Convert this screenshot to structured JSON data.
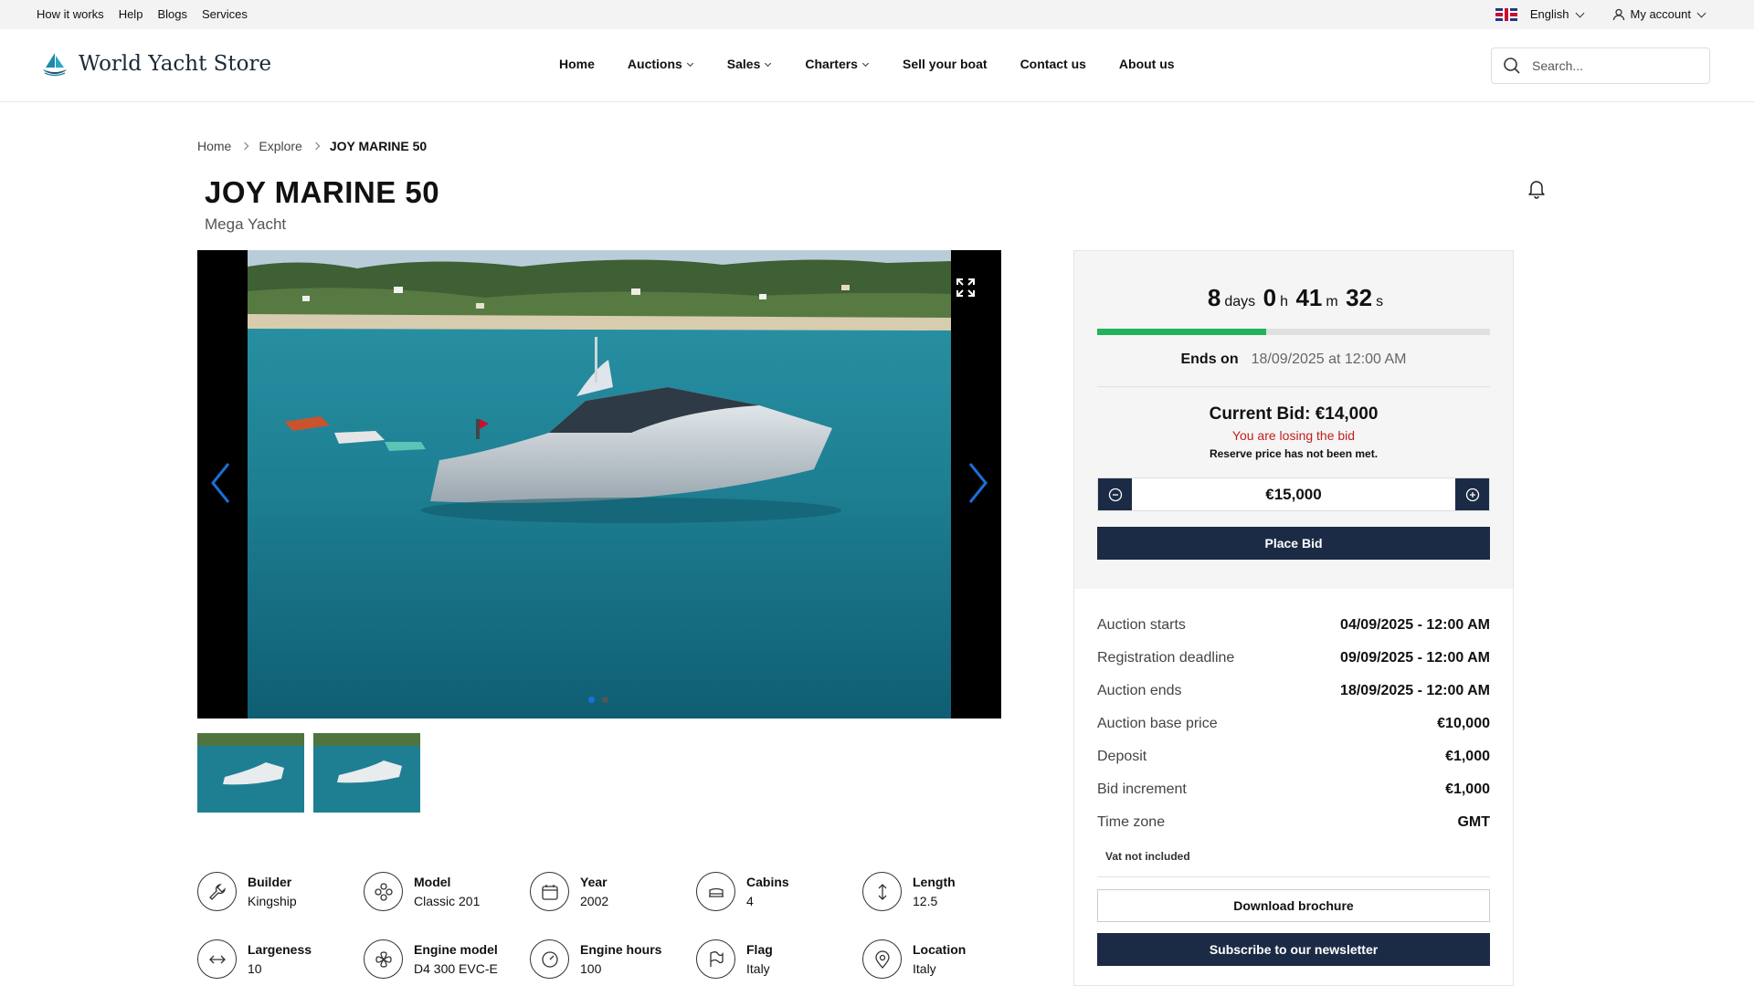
{
  "topbar": {
    "links": [
      "How it works",
      "Help",
      "Blogs",
      "Services"
    ],
    "language": "English",
    "account": "My account"
  },
  "brand": {
    "name": "World Yacht Store"
  },
  "nav": {
    "items": [
      {
        "label": "Home",
        "dropdown": false
      },
      {
        "label": "Auctions",
        "dropdown": true
      },
      {
        "label": "Sales",
        "dropdown": true
      },
      {
        "label": "Charters",
        "dropdown": true
      },
      {
        "label": "Sell your boat",
        "dropdown": false
      },
      {
        "label": "Contact us",
        "dropdown": false
      },
      {
        "label": "About us",
        "dropdown": false
      }
    ]
  },
  "search": {
    "placeholder": "Search..."
  },
  "breadcrumb": {
    "home": "Home",
    "explore": "Explore",
    "current": "JOY MARINE 50"
  },
  "listing": {
    "title": "JOY MARINE 50",
    "subtitle": "Mega Yacht"
  },
  "gallery": {
    "slides": 2,
    "active_slide": 1
  },
  "specs": [
    {
      "label": "Builder",
      "value": "Kingship",
      "icon": "wrench-icon"
    },
    {
      "label": "Model",
      "value": "Classic 201",
      "icon": "model-icon"
    },
    {
      "label": "Year",
      "value": "2002",
      "icon": "calendar-icon"
    },
    {
      "label": "Cabins",
      "value": "4",
      "icon": "bed-icon"
    },
    {
      "label": "Length",
      "value": "12.5",
      "icon": "length-icon"
    },
    {
      "label": "Largeness",
      "value": "10",
      "icon": "width-icon"
    },
    {
      "label": "Engine model",
      "value": "D4 300 EVC-E",
      "icon": "engine-icon"
    },
    {
      "label": "Engine hours",
      "value": "100",
      "icon": "gauge-icon"
    },
    {
      "label": "Flag",
      "value": "Italy",
      "icon": "flag-icon"
    },
    {
      "label": "Location",
      "value": "Italy",
      "icon": "location-pin-icon"
    }
  ],
  "auction": {
    "countdown": {
      "days": "8",
      "days_unit": "days",
      "hours": "0",
      "hours_unit": "h",
      "minutes": "41",
      "minutes_unit": "m",
      "seconds": "32",
      "seconds_unit": "s"
    },
    "progress_fraction": 0.43,
    "ends_label": "Ends on",
    "ends_value": "18/09/2025 at 12:00 AM",
    "current_bid": "Current Bid: €14,000",
    "losing_text": "You are losing the bid",
    "reserve_text": "Reserve price has not been met.",
    "bid_value": "€15,000",
    "place_bid_label": "Place Bid",
    "details": [
      {
        "key": "Auction starts",
        "value": "04/09/2025 - 12:00 AM"
      },
      {
        "key": "Registration deadline",
        "value": "09/09/2025 - 12:00 AM"
      },
      {
        "key": "Auction ends",
        "value": "18/09/2025 - 12:00 AM"
      },
      {
        "key": "Auction base price",
        "value": "€10,000"
      },
      {
        "key": "Deposit",
        "value": "€1,000"
      },
      {
        "key": "Bid increment",
        "value": "€1,000"
      },
      {
        "key": "Time zone",
        "value": "GMT"
      }
    ],
    "vat_note": "Vat not included",
    "brochure_label": "Download brochure",
    "newsletter_label": "Subscribe to our newsletter"
  },
  "colors": {
    "primary": "#1c2b45",
    "progress": "#22b35a",
    "danger": "#c21d1d",
    "active_dot": "#1a6fd8"
  }
}
